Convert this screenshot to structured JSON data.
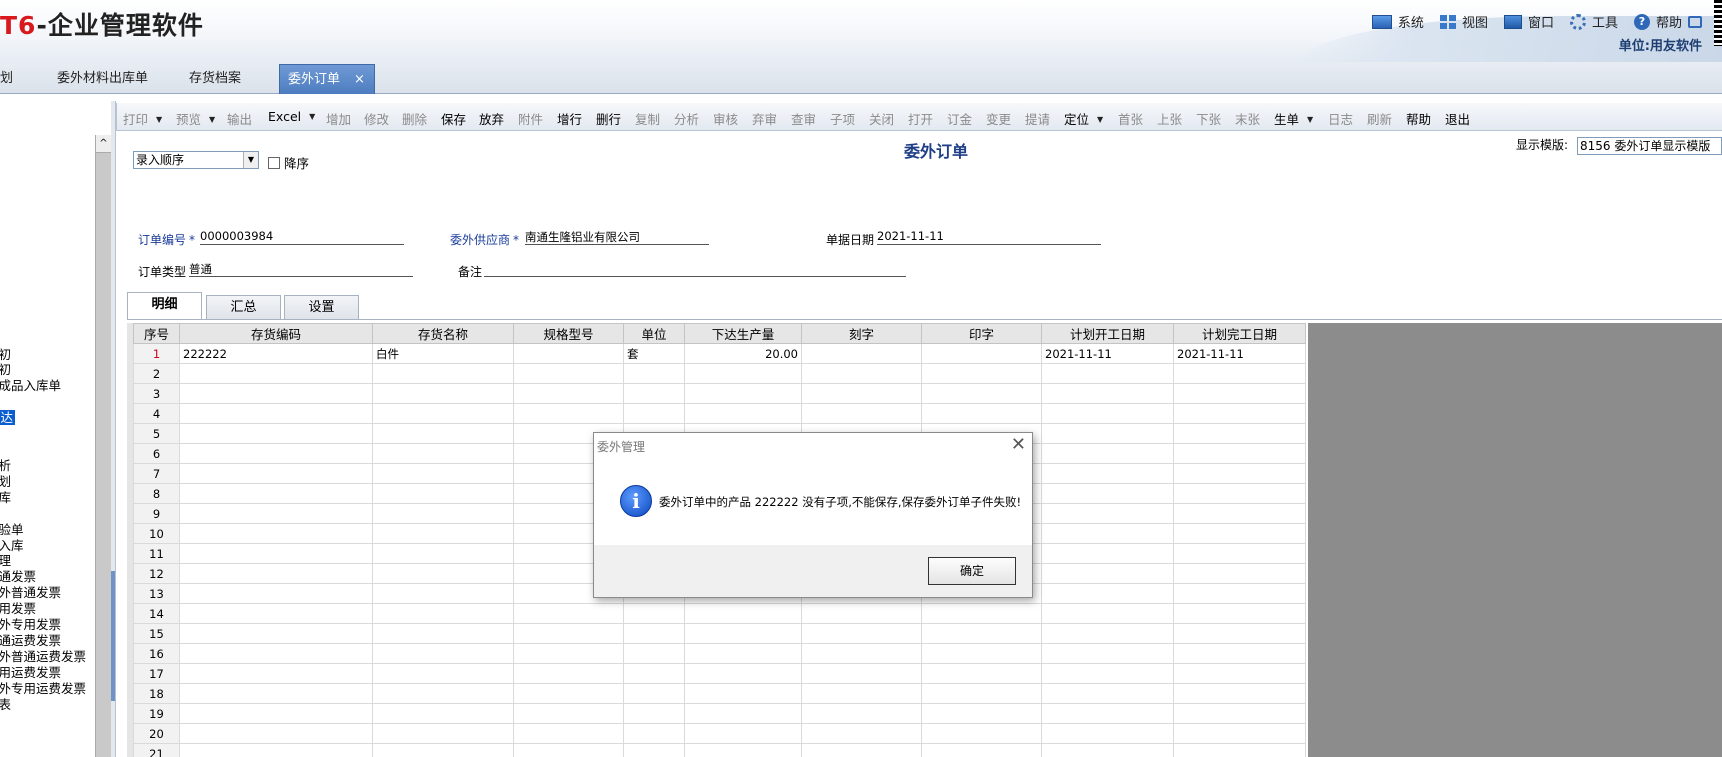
{
  "app": {
    "logo_prefix": "T6",
    "logo_suffix": "-企业管理软件",
    "menu": [
      "系统",
      "视图",
      "窗口",
      "工具",
      "帮助"
    ],
    "unit_label": "单位:用友软件"
  },
  "doc_tabs": [
    {
      "label": "划"
    },
    {
      "label": "委外材料出库单"
    },
    {
      "label": "存货档案"
    },
    {
      "label": "委外订单",
      "active": true,
      "close": "×"
    }
  ],
  "left_nav": {
    "items": [
      "期初",
      "期初",
      "产成品入库单",
      "下达",
      "分析",
      "计划",
      "出库",
      "检验单",
      "品入库",
      "处理",
      "普通发票",
      "委外普通发票",
      "专用发票",
      "委外专用发票",
      "普通运费发票",
      "委外普通运费发票",
      "专用运费发票",
      "委外专用运费发票",
      "报表"
    ],
    "highlighted_index": 3,
    "scroll_up": "^"
  },
  "toolbar": {
    "buttons": [
      {
        "label": "打印",
        "enabled": false,
        "dropdown": true
      },
      {
        "label": "预览",
        "enabled": false,
        "dropdown": true
      },
      {
        "label": "输出",
        "enabled": false
      },
      {
        "label": "Excel",
        "enabled": true,
        "dropdown": true
      },
      {
        "label": "增加",
        "enabled": false
      },
      {
        "label": "修改",
        "enabled": false
      },
      {
        "label": "删除",
        "enabled": false
      },
      {
        "label": "保存",
        "enabled": true
      },
      {
        "label": "放弃",
        "enabled": true
      },
      {
        "label": "附件",
        "enabled": false
      },
      {
        "label": "增行",
        "enabled": true
      },
      {
        "label": "删行",
        "enabled": true
      },
      {
        "label": "复制",
        "enabled": false
      },
      {
        "label": "分析",
        "enabled": false
      },
      {
        "label": "审核",
        "enabled": false
      },
      {
        "label": "弃审",
        "enabled": false
      },
      {
        "label": "查审",
        "enabled": false
      },
      {
        "label": "子项",
        "enabled": false
      },
      {
        "label": "关闭",
        "enabled": false
      },
      {
        "label": "打开",
        "enabled": false
      },
      {
        "label": "订金",
        "enabled": false
      },
      {
        "label": "变更",
        "enabled": false
      },
      {
        "label": "提请",
        "enabled": false
      },
      {
        "label": "定位",
        "enabled": true,
        "dropdown": true
      },
      {
        "label": "首张",
        "enabled": false
      },
      {
        "label": "上张",
        "enabled": false
      },
      {
        "label": "下张",
        "enabled": false
      },
      {
        "label": "末张",
        "enabled": false
      },
      {
        "label": "生单",
        "enabled": true,
        "dropdown": true
      },
      {
        "label": "日志",
        "enabled": false
      },
      {
        "label": "刷新",
        "enabled": false
      },
      {
        "label": "帮助",
        "enabled": true
      },
      {
        "label": "退出",
        "enabled": true
      }
    ]
  },
  "form": {
    "sort_select": "录入顺序",
    "descending_label": "降序",
    "title": "委外订单",
    "template_label": "显示模版:",
    "template_value": "8156 委外订单显示模版",
    "order_no_label": "订单编号",
    "order_no": "0000003984",
    "supplier_label": "委外供应商",
    "supplier": "南通生隆铝业有限公司",
    "date_label": "单据日期",
    "date": "2021-11-11",
    "order_type_label": "订单类型",
    "order_type": "普通",
    "remark_label": "备注",
    "remark": "",
    "required_mark": "*"
  },
  "sub_tabs": [
    "明细",
    "汇总",
    "设置"
  ],
  "grid": {
    "columns": [
      "序号",
      "存货编码",
      "存货名称",
      "规格型号",
      "单位",
      "下达生产量",
      "刻字",
      "印字",
      "计划开工日期",
      "计划完工日期"
    ],
    "rows": [
      [
        "1",
        "222222",
        "白件",
        "",
        "套",
        "20.00",
        "",
        "",
        "2021-11-11",
        "2021-11-11"
      ],
      [
        "2",
        "",
        "",
        "",
        "",
        "",
        "",
        "",
        "",
        ""
      ],
      [
        "3",
        "",
        "",
        "",
        "",
        "",
        "",
        "",
        "",
        ""
      ],
      [
        "4",
        "",
        "",
        "",
        "",
        "",
        "",
        "",
        "",
        ""
      ],
      [
        "5",
        "",
        "",
        "",
        "",
        "",
        "",
        "",
        "",
        ""
      ],
      [
        "6",
        "",
        "",
        "",
        "",
        "",
        "",
        "",
        "",
        ""
      ],
      [
        "7",
        "",
        "",
        "",
        "",
        "",
        "",
        "",
        "",
        ""
      ],
      [
        "8",
        "",
        "",
        "",
        "",
        "",
        "",
        "",
        "",
        ""
      ],
      [
        "9",
        "",
        "",
        "",
        "",
        "",
        "",
        "",
        "",
        ""
      ],
      [
        "10",
        "",
        "",
        "",
        "",
        "",
        "",
        "",
        "",
        ""
      ],
      [
        "11",
        "",
        "",
        "",
        "",
        "",
        "",
        "",
        "",
        ""
      ],
      [
        "12",
        "",
        "",
        "",
        "",
        "",
        "",
        "",
        "",
        ""
      ],
      [
        "13",
        "",
        "",
        "",
        "",
        "",
        "",
        "",
        "",
        ""
      ],
      [
        "14",
        "",
        "",
        "",
        "",
        "",
        "",
        "",
        "",
        ""
      ],
      [
        "15",
        "",
        "",
        "",
        "",
        "",
        "",
        "",
        "",
        ""
      ],
      [
        "16",
        "",
        "",
        "",
        "",
        "",
        "",
        "",
        "",
        ""
      ],
      [
        "17",
        "",
        "",
        "",
        "",
        "",
        "",
        "",
        "",
        ""
      ],
      [
        "18",
        "",
        "",
        "",
        "",
        "",
        "",
        "",
        "",
        ""
      ],
      [
        "19",
        "",
        "",
        "",
        "",
        "",
        "",
        "",
        "",
        ""
      ],
      [
        "20",
        "",
        "",
        "",
        "",
        "",
        "",
        "",
        "",
        ""
      ],
      [
        "21",
        "",
        "",
        "",
        "",
        "",
        "",
        "",
        "",
        ""
      ]
    ]
  },
  "dialog": {
    "title": "委外管理",
    "message": "委外订单中的产品 222222 没有子项,不能保存,保存委外订单子件失败!",
    "ok_label": "确定",
    "close": "✕",
    "icon": "info-icon"
  }
}
